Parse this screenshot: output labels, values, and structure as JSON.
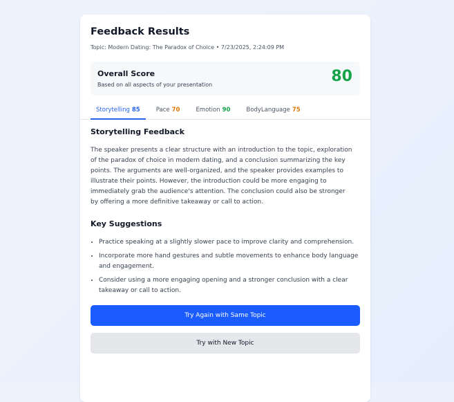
{
  "header": {
    "title": "Feedback Results",
    "subtitle": "Topic: Modern Dating: The Paradox of Choice • 7/23/2025, 2:24:09 PM"
  },
  "overall": {
    "label": "Overall Score",
    "description": "Based on all aspects of your presentation",
    "score": "80",
    "score_color": "#16a34a"
  },
  "tabs": [
    {
      "label": "Storytelling",
      "score": "85",
      "active": true,
      "score_color": "#2563eb"
    },
    {
      "label": "Pace",
      "score": "70",
      "active": false,
      "score_color": "#d97706"
    },
    {
      "label": "Emotion",
      "score": "90",
      "active": false,
      "score_color": "#16a34a"
    },
    {
      "label": "BodyLanguage",
      "score": "75",
      "active": false,
      "score_color": "#d97706"
    }
  ],
  "feedback": {
    "title": "Storytelling Feedback",
    "text": "The speaker presents a clear structure with an introduction to the topic, exploration of the paradox of choice in modern dating, and a conclusion summarizing the key points. The arguments are well-organized, and the speaker provides examples to illustrate their points. However, the introduction could be more engaging to immediately grab the audience's attention. The conclusion could also be stronger by offering a more definitive takeaway or call to action."
  },
  "suggestions": {
    "title": "Key Suggestions",
    "items": [
      "Practice speaking at a slightly slower pace to improve clarity and comprehension.",
      "Incorporate more hand gestures and subtle movements to enhance body language and engagement.",
      "Consider using a more engaging opening and a stronger conclusion with a clear takeaway or call to action."
    ]
  },
  "buttons": {
    "retry_same": "Try Again with Same Topic",
    "retry_new": "Try with New Topic"
  },
  "colors": {
    "accent": "#1a5cff",
    "good": "#16a34a",
    "medium": "#d97706"
  }
}
